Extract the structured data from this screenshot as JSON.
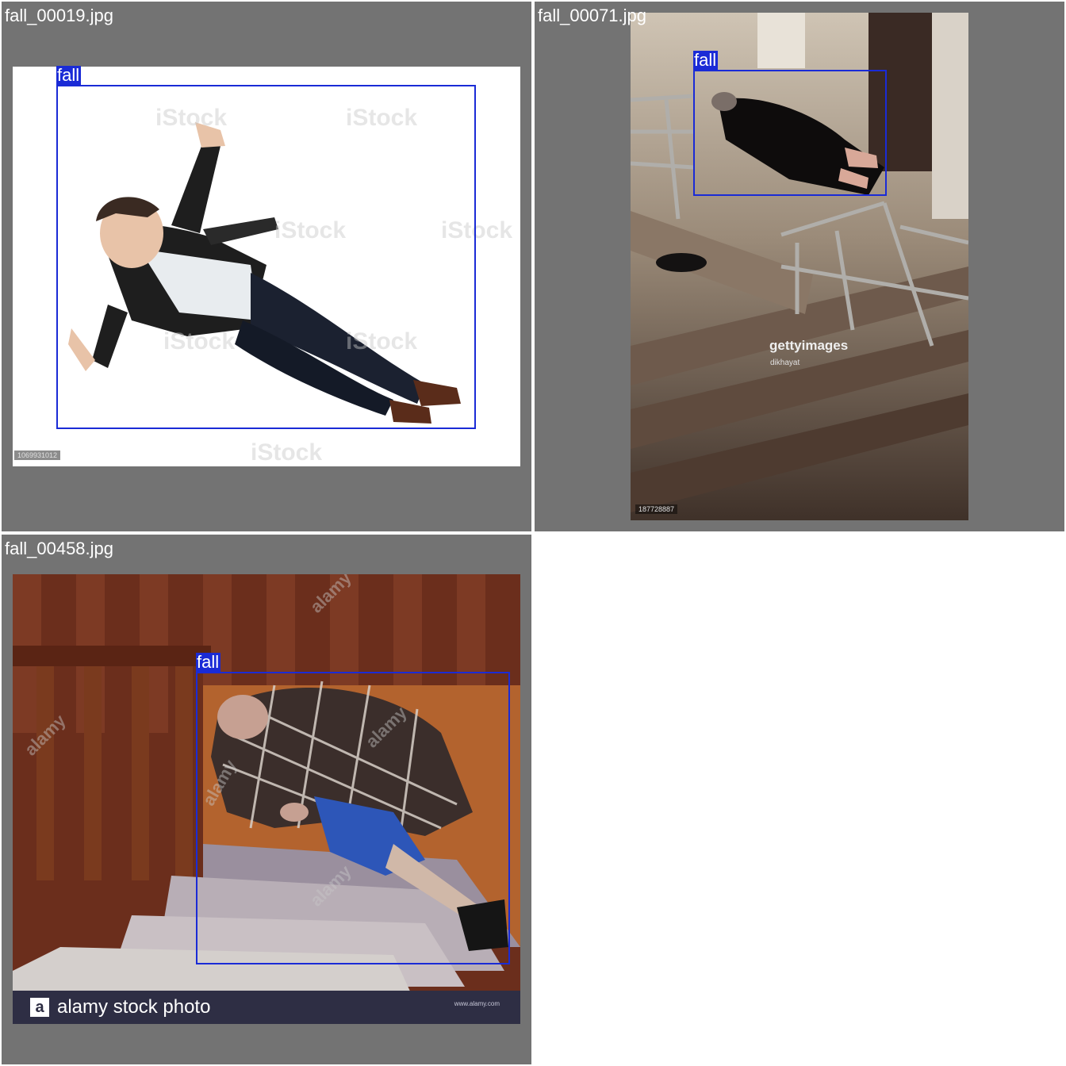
{
  "tiles": [
    {
      "filename": "fall_00019.jpg",
      "detection_label": "fall",
      "watermark": "iStock",
      "stock_id": "1069931012"
    },
    {
      "filename": "fall_00071.jpg",
      "detection_label": "fall",
      "watermark": "gettyimages",
      "watermark_credit": "dikhayat",
      "stock_id": "187728887"
    },
    {
      "filename": "fall_00458.jpg",
      "detection_label": "fall",
      "watermark": "alamy",
      "footer_text": "alamy stock photo",
      "footer_logo_letter": "a",
      "footer_small": "www.alamy.com"
    }
  ],
  "colors": {
    "tile_background": "#737373",
    "bbox": "#1a2bd6",
    "page_background": "#ffffff"
  }
}
